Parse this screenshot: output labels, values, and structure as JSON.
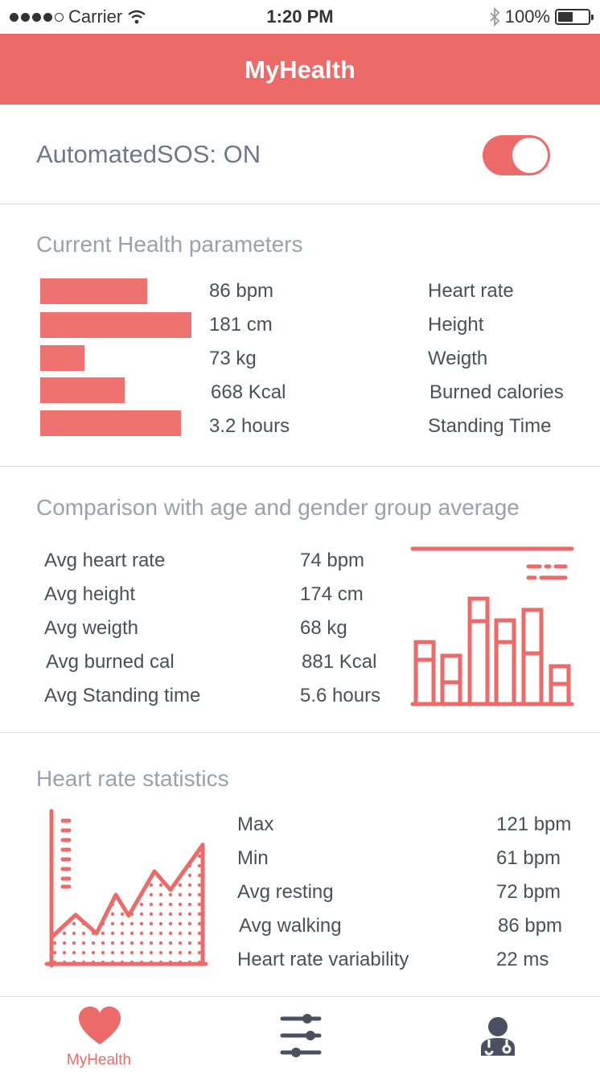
{
  "status_bar": {
    "carrier": "Carrier",
    "time": "1:20 PM",
    "battery": "100%"
  },
  "header": {
    "title": "MyHealth"
  },
  "sos": {
    "label": "AutomatedSOS: ON",
    "enabled": true
  },
  "current": {
    "title": "Current Health parameters",
    "items": [
      {
        "value": "86 bpm",
        "label": "Heart rate",
        "bar_level": 0.71
      },
      {
        "value": "181 cm",
        "label": "Height",
        "bar_level": 1.0
      },
      {
        "value": "73 kg",
        "label": "Weigth",
        "bar_level": 0.29
      },
      {
        "value": "668 Kcal",
        "label": "Burned calories",
        "bar_level": 0.56
      },
      {
        "value": "3.2 hours",
        "label": "Standing Time",
        "bar_level": 0.93
      }
    ]
  },
  "comparison": {
    "title": "Comparison with age and gender group average",
    "items": [
      {
        "label": "Avg heart rate",
        "value": "74 bpm"
      },
      {
        "label": "Avg height",
        "value": "174 cm"
      },
      {
        "label": "Avg weigth",
        "value": "68 kg"
      },
      {
        "label": "Avg burned cal",
        "value": "881 Kcal"
      },
      {
        "label": "Avg Standing time",
        "value": "5.6 hours"
      }
    ]
  },
  "heart_stats": {
    "title": "Heart rate statistics",
    "items": [
      {
        "label": "Max",
        "value": "121 bpm"
      },
      {
        "label": "Min",
        "value": "61 bpm"
      },
      {
        "label": "Avg resting",
        "value": "72 bpm"
      },
      {
        "label": "Avg walking",
        "value": "86 bpm"
      },
      {
        "label": "Heart rate variability",
        "value": "22 ms"
      }
    ]
  },
  "tabs": [
    {
      "label": "MyHealth",
      "icon": "heart-icon",
      "active": true
    },
    {
      "label": "",
      "icon": "sliders-icon",
      "active": false
    },
    {
      "label": "",
      "icon": "doctor-icon",
      "active": false
    }
  ],
  "colors": {
    "accent": "#ec6b69",
    "bar": "#ee7270",
    "title_gray": "#9aa1ab",
    "text": "#4a4f5a"
  }
}
